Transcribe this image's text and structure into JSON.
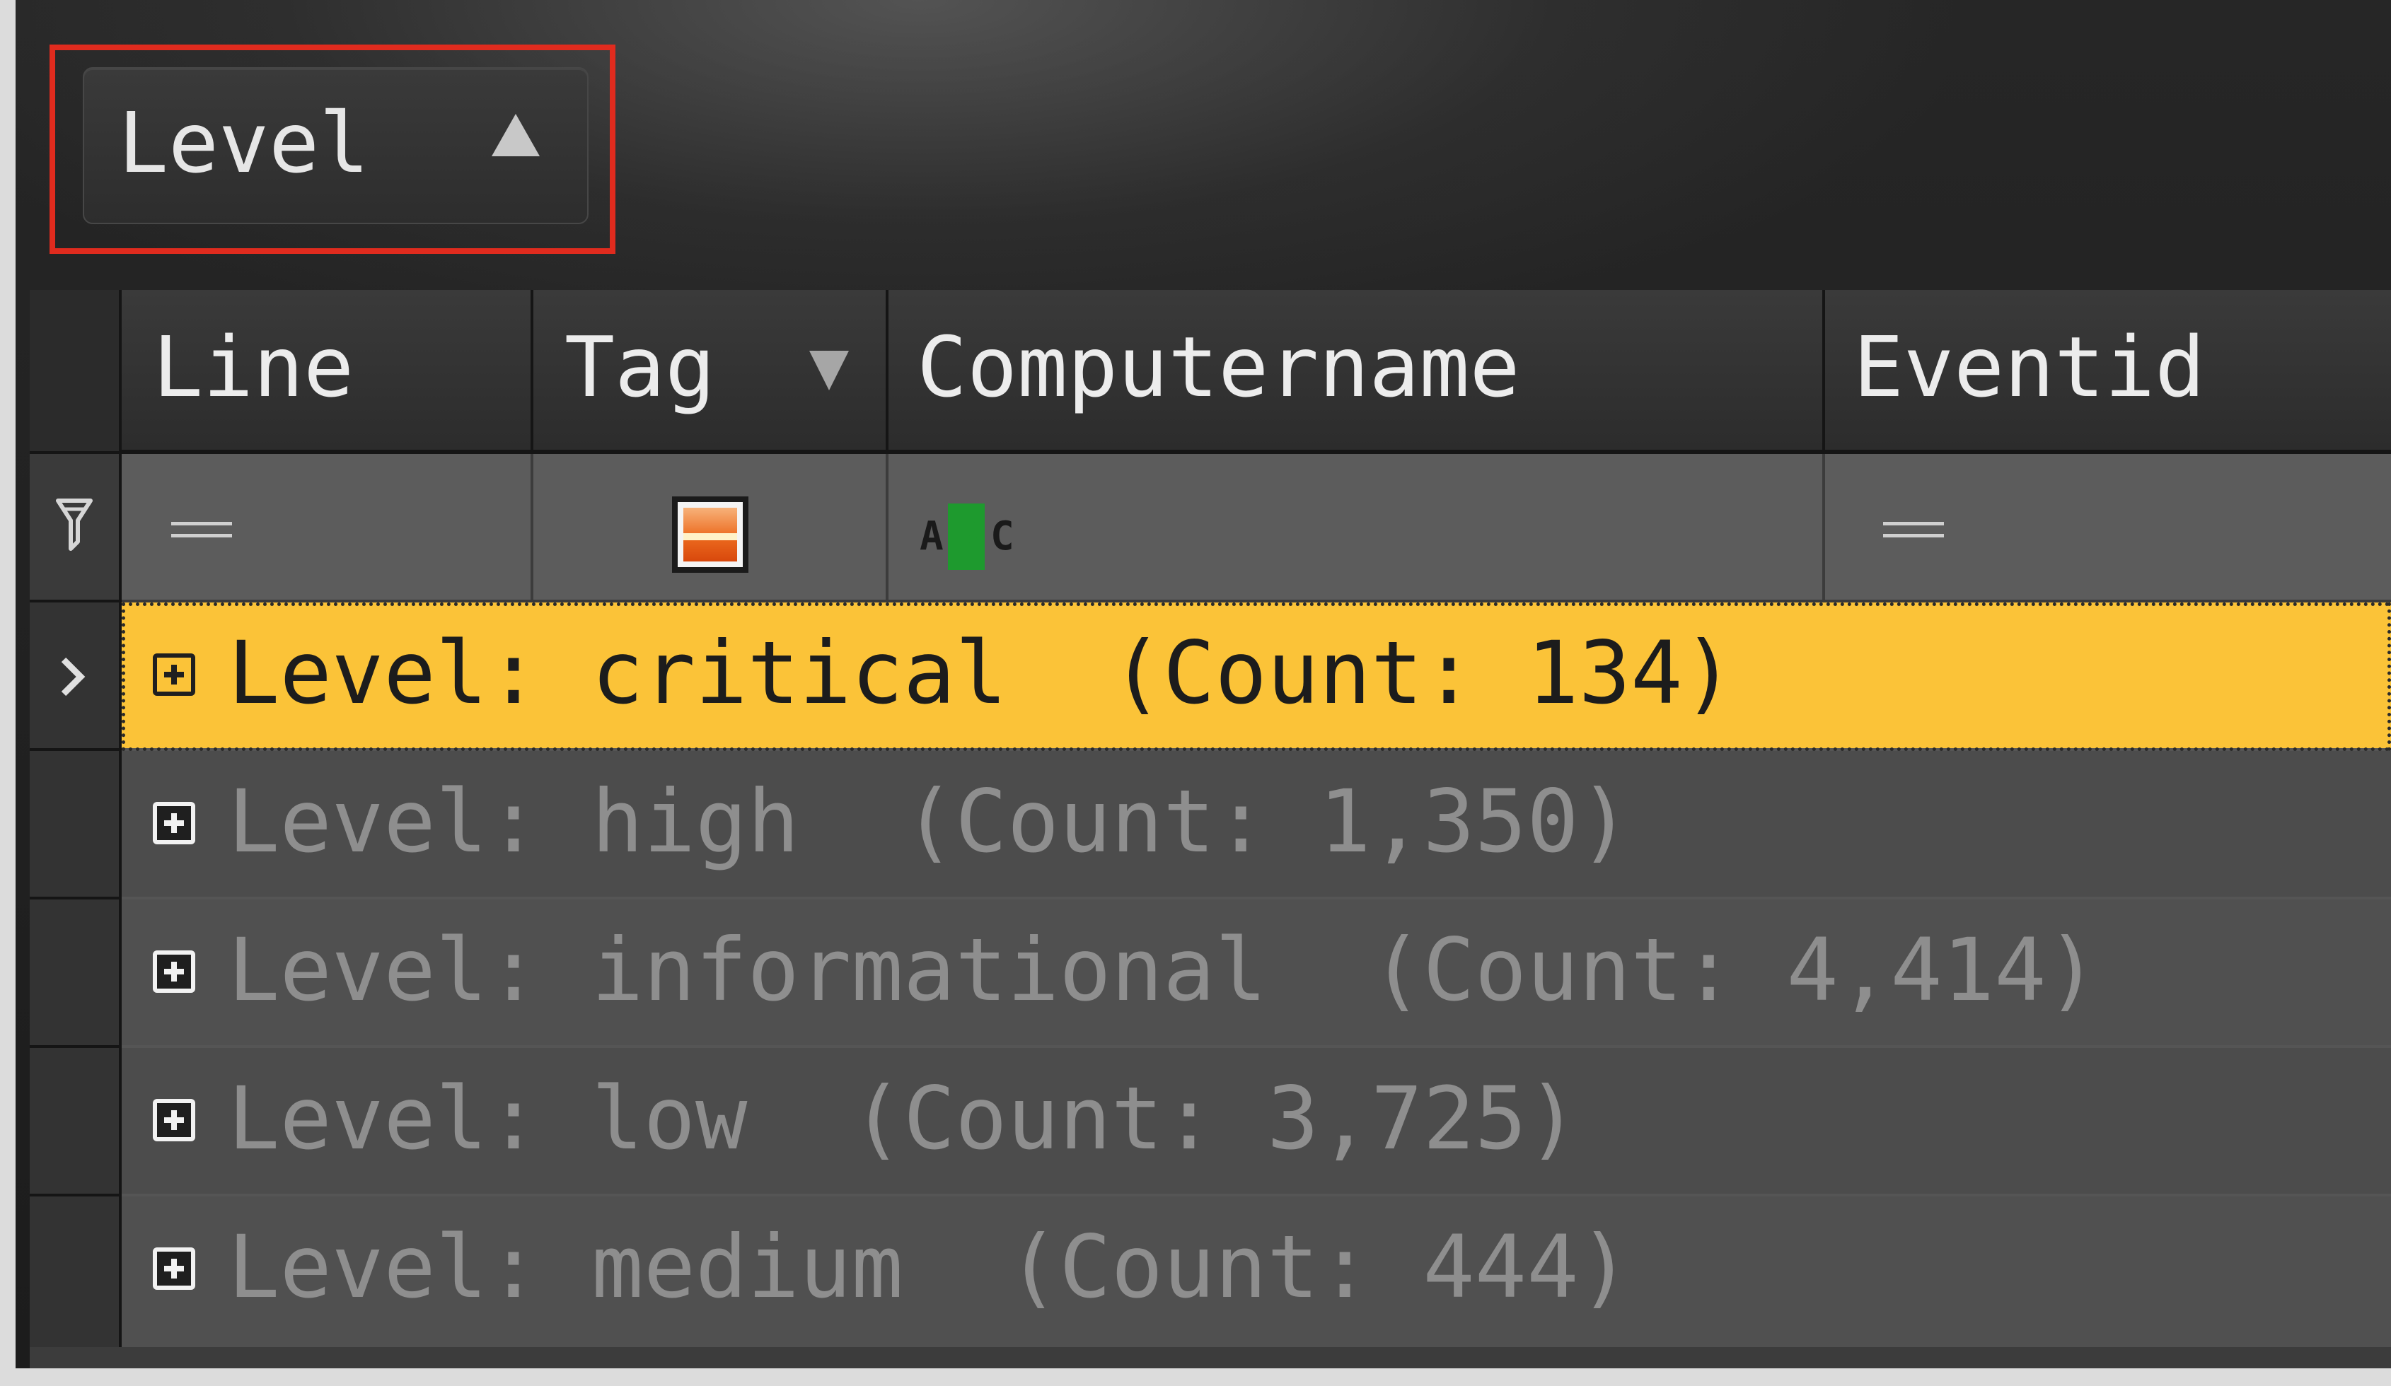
{
  "group_panel": {
    "chip_label": "Level",
    "chip_sort": "ascending",
    "highlight_color": "#e02b1e"
  },
  "columns": [
    {
      "label": "Line",
      "filter": "equals"
    },
    {
      "label": "Tag",
      "filter": "tag",
      "has_filter_arrow": true
    },
    {
      "label": "Computername",
      "filter": "text"
    },
    {
      "label": "Eventid",
      "filter": "equals"
    }
  ],
  "groups": [
    {
      "text": "Level: critical  (Count: 134)",
      "selected": true
    },
    {
      "text": "Level: high  (Count: 1,350)",
      "selected": false
    },
    {
      "text": "Level: informational  (Count: 4,414)",
      "selected": false
    },
    {
      "text": "Level: low  (Count: 3,725)",
      "selected": false
    },
    {
      "text": "Level: medium  (Count: 444)",
      "selected": false
    }
  ],
  "icons": {
    "row_indicator": "chevron-right-icon",
    "filter_row": "funnel-icon",
    "expand": "plus-box-icon",
    "tag_filter": "tag-color-icon",
    "text_filter": "abc-icon",
    "equals_filter": "equals-icon"
  },
  "colors": {
    "selected_row": "#fbc338",
    "group_text": "#8e8e8e",
    "header_text": "#ececec",
    "abc_highlight": "#1e9a2e",
    "tag_icon": "#ec6a1e"
  }
}
